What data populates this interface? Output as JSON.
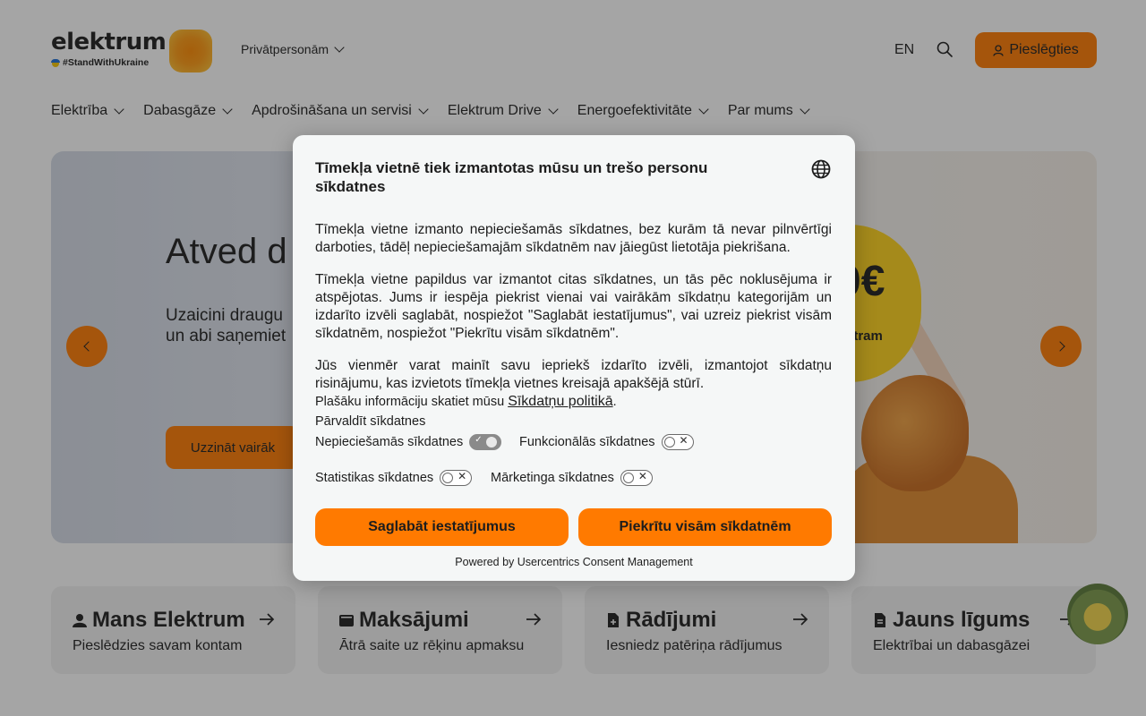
{
  "header": {
    "logo_word": "elektrum",
    "logo_tagline": "#StandWithUkraine",
    "segment": "Privātpersonām",
    "language": "EN",
    "login_label": "Pieslēgties"
  },
  "nav": [
    {
      "label": "Elektrība"
    },
    {
      "label": "Dabasgāze"
    },
    {
      "label": "Apdrošināšana un servisi"
    },
    {
      "label": "Elektrum Drive"
    },
    {
      "label": "Energoefektivitāte"
    },
    {
      "label": "Par mums"
    }
  ],
  "hero": {
    "title": "Atved d",
    "text_line1": "Uzaicini draugu",
    "text_line2": "un abi saņemiet",
    "cta": "Uzzināt vairāk",
    "promo_amount": "0€",
    "promo_sub": "atram"
  },
  "cards": [
    {
      "title": "Mans Elektrum",
      "subtitle": "Pieslēdzies savam kontam",
      "icon": "user-icon"
    },
    {
      "title": "Maksājumi",
      "subtitle": "Ātrā saite uz rēķinu apmaksu",
      "icon": "wallet-icon"
    },
    {
      "title": "Rādījumi",
      "subtitle": "Iesniedz patēriņa rādījumus",
      "icon": "file-plus-icon"
    },
    {
      "title": "Jauns līgums",
      "subtitle": "Elektrībai un dabasgāzei",
      "icon": "document-icon"
    }
  ],
  "consent": {
    "title": "Tīmekļa vietnē tiek izmantotas mūsu un trešo personu sīkdatnes",
    "p1": "Tīmekļa vietne izmanto nepieciešamās sīkdatnes, bez kurām tā nevar pilnvērtīgi darboties, tādēļ nepieciešamajām sīkdatnēm nav jāiegūst lietotāja piekrišana.",
    "p2": "Tīmekļa vietne papildus var izmantot citas sīkdatnes, un tās pēc noklusējuma ir atspējotas. Jums ir iespēja piekrist vienai vai vairākām sīkdatņu kategorijām un izdarīto izvēli saglabāt, nospiežot \"Saglabāt iestatījumus\", vai uzreiz piekrist visām sīkdatnēm, nospiežot \"Piekrītu visām sīkdatnēm\".",
    "p3": "Jūs vienmēr varat mainīt savu iepriekš izdarīto izvēli, izmantojot sīkdatņu risinājumu, kas izvietots tīmekļa vietnes kreisajā apakšējā stūrī.",
    "more_prefix": "Plašāku informāciju skatiet mūsu",
    "more_link": "Sīkdatņu politikā",
    "more_suffix": ".",
    "manage_label": "Pārvaldīt sīkdatnes",
    "toggles": [
      {
        "label": "Nepieciešamās sīkdatnes",
        "checked": true,
        "disabled": true
      },
      {
        "label": "Funkcionālās sīkdatnes",
        "checked": false
      },
      {
        "label": "Statistikas sīkdatnes",
        "checked": false
      },
      {
        "label": "Mārketinga sīkdatnes",
        "checked": false
      }
    ],
    "save_label": "Saglabāt iestatījumus",
    "accept_label": "Piekrītu visām sīkdatnēm",
    "powered": "Powered by Usercentrics Consent Management"
  },
  "colors": {
    "accent": "#ff7a00",
    "promo": "#ffd21a"
  }
}
